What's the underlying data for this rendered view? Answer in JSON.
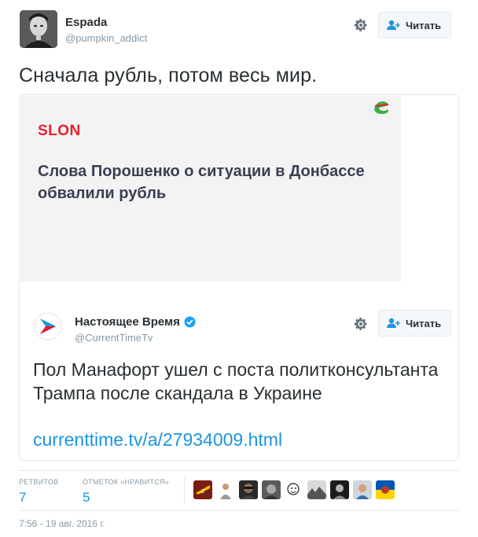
{
  "author": {
    "name": "Espada",
    "handle": "@pumpkin_addict",
    "avatar_icon": "avatar-portrait"
  },
  "follow_button": {
    "label": "Читать",
    "icon": "add-user-icon"
  },
  "tweet": {
    "text": "Сначала рубль, потом весь мир."
  },
  "card": {
    "brand": "SLON",
    "headline": "Слова Порошенко о ситуации в Донбассе обвалили рубль"
  },
  "quoted": {
    "name": "Настоящее Время",
    "handle": "@CurrentTimeTv",
    "verified": true,
    "text": "Пол Манафорт ушел с поста политконсультанта Трампа после скандала в Украине",
    "link": "currenttime.tv/a/27934009.html",
    "follow_label": "Читать"
  },
  "stats": {
    "retweets_label": "РЕТВИТОВ",
    "retweets": "7",
    "likes_label": "ОТМЕТОК «НРАВИТСЯ»",
    "likes": "5"
  },
  "timestamp": "7:56 - 19 авг. 2016 г.",
  "colors": {
    "accent": "#1b95e0",
    "slon_red": "#e8212e",
    "text": "#292f33",
    "muted": "#8899a6",
    "border": "#e1e8ed"
  }
}
